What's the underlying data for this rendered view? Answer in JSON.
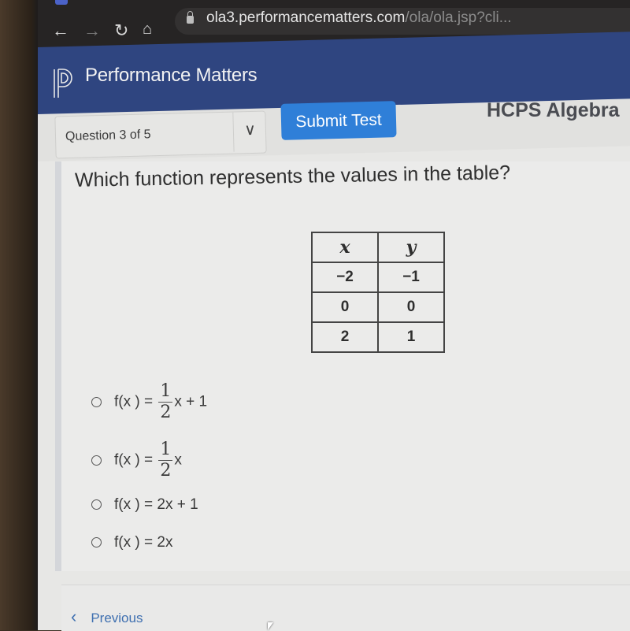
{
  "browser": {
    "url_host": "ola3.performancematters.com",
    "url_path": "/ola/ola.jsp?cli...",
    "icons": [
      "back-arrow-icon",
      "forward-arrow-icon",
      "reload-icon",
      "home-icon",
      "lock-icon"
    ]
  },
  "header": {
    "brand": "Performance Matters"
  },
  "toolbar": {
    "question_selector": "Question 3 of 5",
    "submit_label": "Submit Test",
    "course_title": "HCPS Algebra"
  },
  "question": {
    "text": "Which function represents the values in the table?",
    "table": {
      "headers": [
        "x",
        "y"
      ],
      "rows": [
        [
          "−2",
          "−1"
        ],
        [
          "0",
          "0"
        ],
        [
          "2",
          "1"
        ]
      ]
    },
    "options": [
      {
        "prefix": "f(x ) =",
        "frac_num": "1",
        "frac_den": "2",
        "suffix": "x + 1"
      },
      {
        "prefix": "f(x ) =",
        "frac_num": "1",
        "frac_den": "2",
        "suffix": "x"
      },
      {
        "prefix": "f(x ) =",
        "text": "2x + 1"
      },
      {
        "prefix": "f(x ) =",
        "text": "2x"
      }
    ]
  },
  "footer": {
    "previous_label": "Previous"
  }
}
